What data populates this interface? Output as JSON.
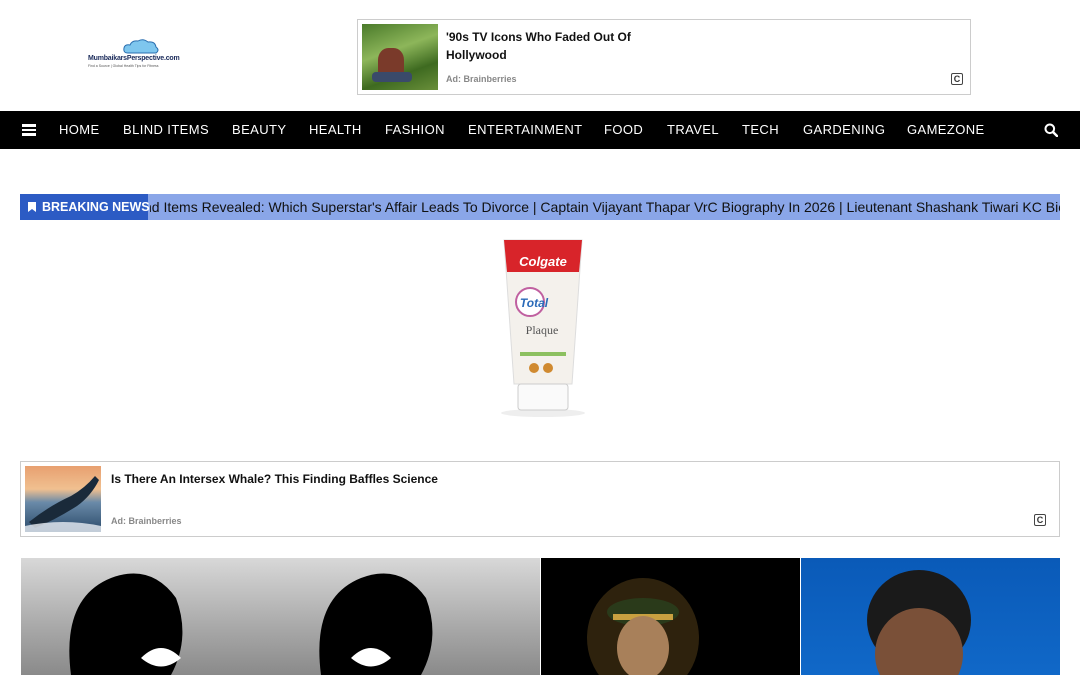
{
  "logo": {
    "name": "MumbaikarsPerspective.com",
    "tagline": "Find a Source | Global Health Tips for Fitness"
  },
  "ad_top": {
    "title": "'90s TV Icons Who Faded Out Of Hollywood",
    "source": "Ad: Brainberries",
    "badge": "C"
  },
  "nav": {
    "items": [
      "HOME",
      "BLIND ITEMS",
      "BEAUTY",
      "HEALTH",
      "FASHION",
      "ENTERTAINMENT",
      "FOOD",
      "TRAVEL",
      "TECH",
      "GARDENING",
      "GAMEZONE"
    ]
  },
  "breaking": {
    "label": "BREAKING NEWS",
    "ticker": "nd Items Revealed: Which Superstar's Affair Leads To Divorce | Captain Vijayant Thapar VrC Biography In 2026 | Lieutenant Shashank Tiwari KC Biography"
  },
  "product": {
    "brand": "Colgate",
    "line": "Total",
    "variant": "Plaque"
  },
  "ad_mid": {
    "title": "Is There An Intersex Whale? This Finding Baffles Science",
    "source": "Ad: Brainberries",
    "badge": "C"
  },
  "colors": {
    "nav_bg": "#000000",
    "breaking_label": "#2c5bc4",
    "breaking_bg": "#8aa6e8"
  }
}
